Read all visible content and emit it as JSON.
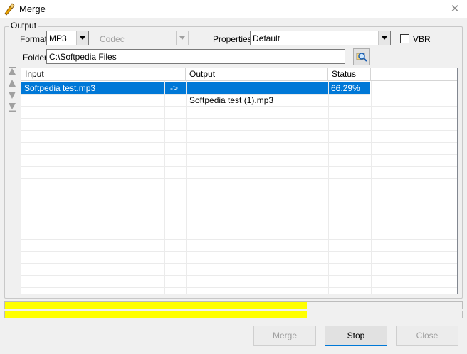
{
  "window": {
    "title": "Merge"
  },
  "output_group": {
    "label": "Output"
  },
  "format": {
    "label": "Format",
    "value": "MP3"
  },
  "codec": {
    "label": "Codec",
    "value": ""
  },
  "properties": {
    "label": "Properties",
    "value": "Default"
  },
  "vbr": {
    "label": "VBR",
    "checked": false
  },
  "folder": {
    "label": "Folder",
    "value": "C:\\Softpedia Files"
  },
  "table": {
    "columns": [
      "Input",
      "",
      "Output",
      "Status"
    ],
    "rows": [
      {
        "input": "Softpedia test.mp3",
        "arrow": "->",
        "output": "",
        "status": "66.29%",
        "selected": true
      },
      {
        "input": "",
        "arrow": "",
        "output": "Softpedia test (1).mp3",
        "status": "",
        "selected": false
      }
    ]
  },
  "progress": {
    "file_fraction": 0.66,
    "total_fraction": 0.66,
    "color": "#ffff00"
  },
  "buttons": {
    "merge": "Merge",
    "stop": "Stop",
    "close": "Close"
  },
  "colors": {
    "selection": "#0078d7",
    "accent_icon": "#e8a200"
  }
}
